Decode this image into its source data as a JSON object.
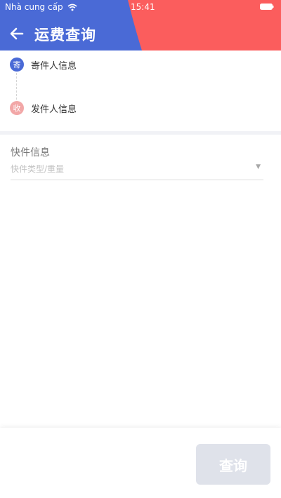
{
  "status_bar": {
    "carrier": "Nhà cung cấp",
    "time": "15:41"
  },
  "header": {
    "title": "运费查询",
    "colors": {
      "left": "#4a6ad6",
      "right": "#fb5d5d"
    }
  },
  "address": {
    "sender": {
      "badge": "寄",
      "label": "寄件人信息"
    },
    "receiver": {
      "badge": "收",
      "label": "发件人信息"
    }
  },
  "package": {
    "section_title": "快件信息",
    "type_weight_placeholder": "快件类型/重量"
  },
  "actions": {
    "query_label": "查询"
  }
}
